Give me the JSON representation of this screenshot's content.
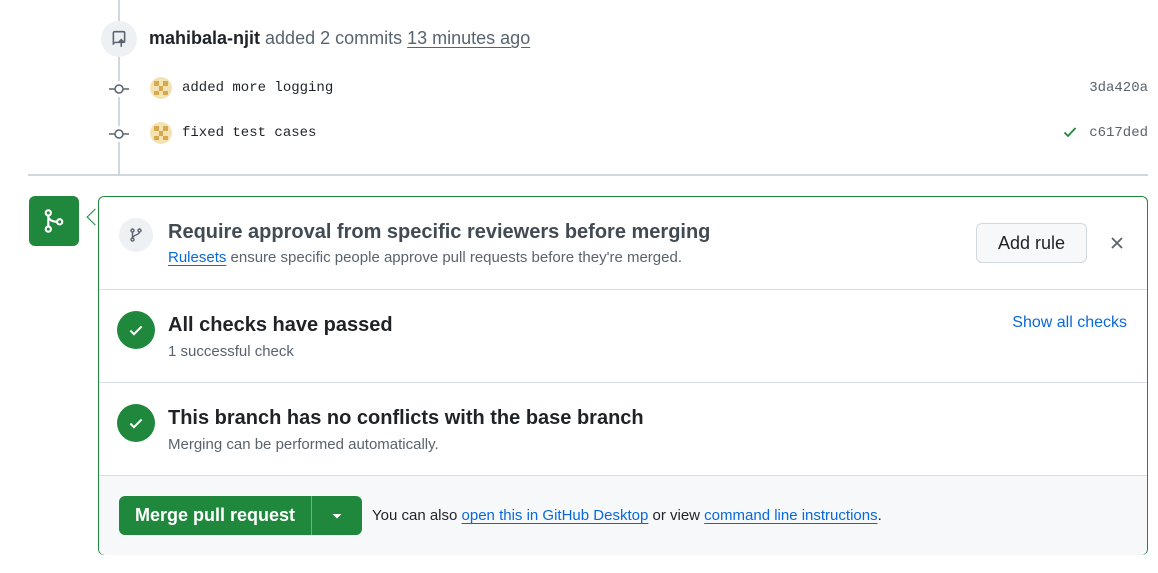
{
  "push_event": {
    "actor": "mahibala-njit",
    "verb": "added 2 commits",
    "time": "13 minutes ago"
  },
  "commits": [
    {
      "message": "added more logging",
      "sha": "3da420a",
      "checked": false
    },
    {
      "message": "fixed test cases",
      "sha": "c617ded",
      "checked": true
    }
  ],
  "ruleset": {
    "title": "Require approval from specific reviewers before merging",
    "link": "Rulesets",
    "description": " ensure specific people approve pull requests before they're merged.",
    "add_rule_label": "Add rule"
  },
  "checks": {
    "title": "All checks have passed",
    "subtitle": "1 successful check",
    "show_all_label": "Show all checks"
  },
  "conflicts": {
    "title": "This branch has no conflicts with the base branch",
    "subtitle": "Merging can be performed automatically."
  },
  "merge": {
    "button_label": "Merge pull request",
    "note_prefix": "You can also ",
    "desktop_link": "open this in GitHub Desktop",
    "note_middle": " or view ",
    "cli_link": "command line instructions",
    "note_suffix": "."
  },
  "colors": {
    "success": "#1f883d",
    "link": "#0969da",
    "muted": "#59636e"
  }
}
